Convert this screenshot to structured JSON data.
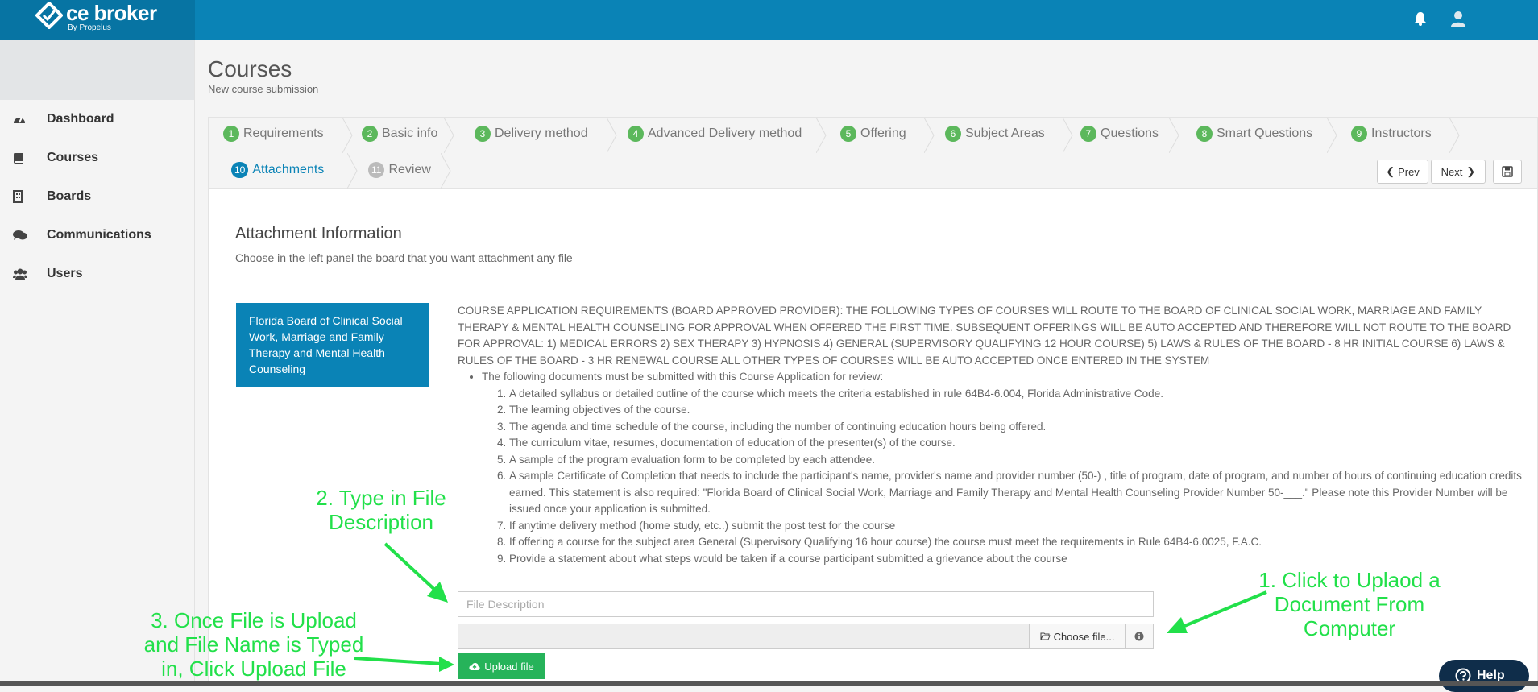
{
  "brand": {
    "name": "ce broker",
    "byline": "By Propelus",
    "accent": "#0a83b6"
  },
  "topbar": {
    "bell_icon": "bell-icon",
    "user_icon": "user-icon"
  },
  "sidebar": {
    "items": [
      {
        "label": "Dashboard",
        "icon": "dashboard-icon"
      },
      {
        "label": "Courses",
        "icon": "book-icon"
      },
      {
        "label": "Boards",
        "icon": "building-icon"
      },
      {
        "label": "Communications",
        "icon": "comments-icon"
      },
      {
        "label": "Users",
        "icon": "users-icon"
      }
    ]
  },
  "page": {
    "title": "Courses",
    "subtitle": "New course submission"
  },
  "wizard": {
    "steps": [
      {
        "num": "1",
        "label": "Requirements"
      },
      {
        "num": "2",
        "label": "Basic info"
      },
      {
        "num": "3",
        "label": "Delivery method"
      },
      {
        "num": "4",
        "label": "Advanced Delivery method"
      },
      {
        "num": "5",
        "label": "Offering"
      },
      {
        "num": "6",
        "label": "Subject Areas"
      },
      {
        "num": "7",
        "label": "Questions"
      },
      {
        "num": "8",
        "label": "Smart Questions"
      },
      {
        "num": "9",
        "label": "Instructors"
      },
      {
        "num": "10",
        "label": "Attachments"
      },
      {
        "num": "11",
        "label": "Review"
      }
    ],
    "prev_label": "Prev",
    "next_label": "Next"
  },
  "attachments": {
    "title": "Attachment Information",
    "subtitle": "Choose in the left panel the board that you want attachment any file",
    "board_name": "Florida Board of Clinical Social Work, Marriage and Family Therapy and Mental Health Counseling",
    "requirements_intro": "COURSE APPLICATION REQUIREMENTS (BOARD APPROVED PROVIDER): THE FOLLOWING TYPES OF COURSES WILL ROUTE TO THE BOARD OF CLINICAL SOCIAL WORK, MARRIAGE AND FAMILY THERAPY & MENTAL HEALTH COUNSELING FOR APPROVAL WHEN OFFERED THE FIRST TIME. SUBSEQUENT OFFERINGS WILL BE AUTO ACCEPTED AND THEREFORE WILL NOT ROUTE TO THE BOARD FOR APPROVAL: 1) MEDICAL ERRORS 2) SEX THERAPY 3) HYPNOSIS 4) GENERAL (SUPERVISORY QUALIFYING 12 HOUR COURSE) 5) LAWS & RULES OF THE BOARD - 8 HR INITIAL COURSE 6) LAWS & RULES OF THE BOARD - 3 HR RENEWAL COURSE ALL OTHER TYPES OF COURSES WILL BE AUTO ACCEPTED ONCE ENTERED IN THE SYSTEM",
    "bullet": "The following documents must be submitted with this Course Application for review:",
    "docs": [
      "A detailed syllabus or detailed outline of the course which meets the criteria established in rule 64B4-6.004, Florida Administrative Code.",
      "The learning objectives of the course.",
      "The agenda and time schedule of the course, including the number of continuing education hours being offered.",
      "The curriculum vitae, resumes, documentation of education of the presenter(s) of the course.",
      "A sample of the program evaluation form to be completed by each attendee.",
      "A sample Certificate of Completion that needs to include the participant's name, provider's name and provider number (50-) , title of program, date of program, and number of hours of continuing education credits earned. This statement is also required: \"Florida Board of Clinical Social Work, Marriage and Family Therapy and Mental Health Counseling Provider Number 50-___.\" Please note this Provider Number will be issued once your application is submitted.",
      "If anytime delivery method (home study, etc..) submit the post test for the course",
      "If offering a course for the subject area General (Supervisory Qualifying 16 hour course) the course must meet the requirements in Rule 64B4-6.0025, F.A.C.",
      "Provide a statement about what steps would be taken if a course participant submitted a grievance about the course"
    ],
    "file_description_placeholder": "File Description",
    "file_description_value": "",
    "choose_file_label": "Choose file...",
    "upload_label": "Upload file"
  },
  "annotations": {
    "a1": [
      "1. Click to Uplaod a",
      "Document From",
      "Computer"
    ],
    "a2": [
      "2. Type in File",
      "Description"
    ],
    "a3": [
      "3. Once File is Upload",
      "and File Name is Typed",
      "in, Click Upload File"
    ],
    "color": "#22e04a"
  },
  "help": {
    "label": "Help"
  }
}
